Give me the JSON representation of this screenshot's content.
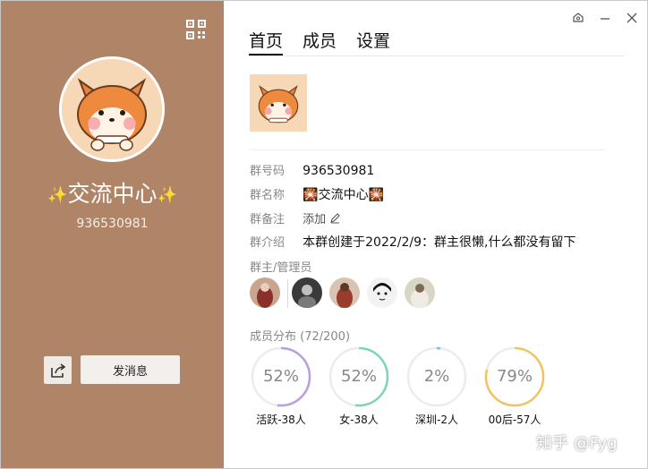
{
  "left_panel": {
    "bg_color": "#b08567",
    "qr_icon": "qr-code-icon",
    "group_name": "交流中心",
    "group_id": "936530981",
    "send_button": "发消息",
    "share_icon": "share-icon"
  },
  "window_controls": [
    "pin-icon",
    "minimize-icon",
    "close-icon"
  ],
  "tabs": [
    {
      "label": "首页",
      "active": true
    },
    {
      "label": "成员",
      "active": false
    },
    {
      "label": "设置",
      "active": false
    }
  ],
  "info": {
    "group_number": {
      "label": "群号码",
      "value": "936530981"
    },
    "group_name": {
      "label": "群名称",
      "value": "🎇交流中心🎇"
    },
    "group_remark": {
      "label": "群备注",
      "value": "添加"
    },
    "group_intro": {
      "label": "群介绍",
      "value": "本群创建于2022/2/9：群主很懒,什么都没有留下"
    }
  },
  "admins_title": "群主/管理员",
  "members_title": "成员分布 (72/200)",
  "stats": [
    {
      "percent": "52%",
      "value": 52,
      "label": "活跃-38人",
      "color": "#b99ee0"
    },
    {
      "percent": "52%",
      "value": 52,
      "label": "女-38人",
      "color": "#7fd6b4"
    },
    {
      "percent": "2%",
      "value": 2,
      "label": "深圳-2人",
      "color": "#6ec7e8"
    },
    {
      "percent": "79%",
      "value": 79,
      "label": "00后-57人",
      "color": "#f3c261"
    }
  ],
  "watermark": "知乎 @Fyg"
}
